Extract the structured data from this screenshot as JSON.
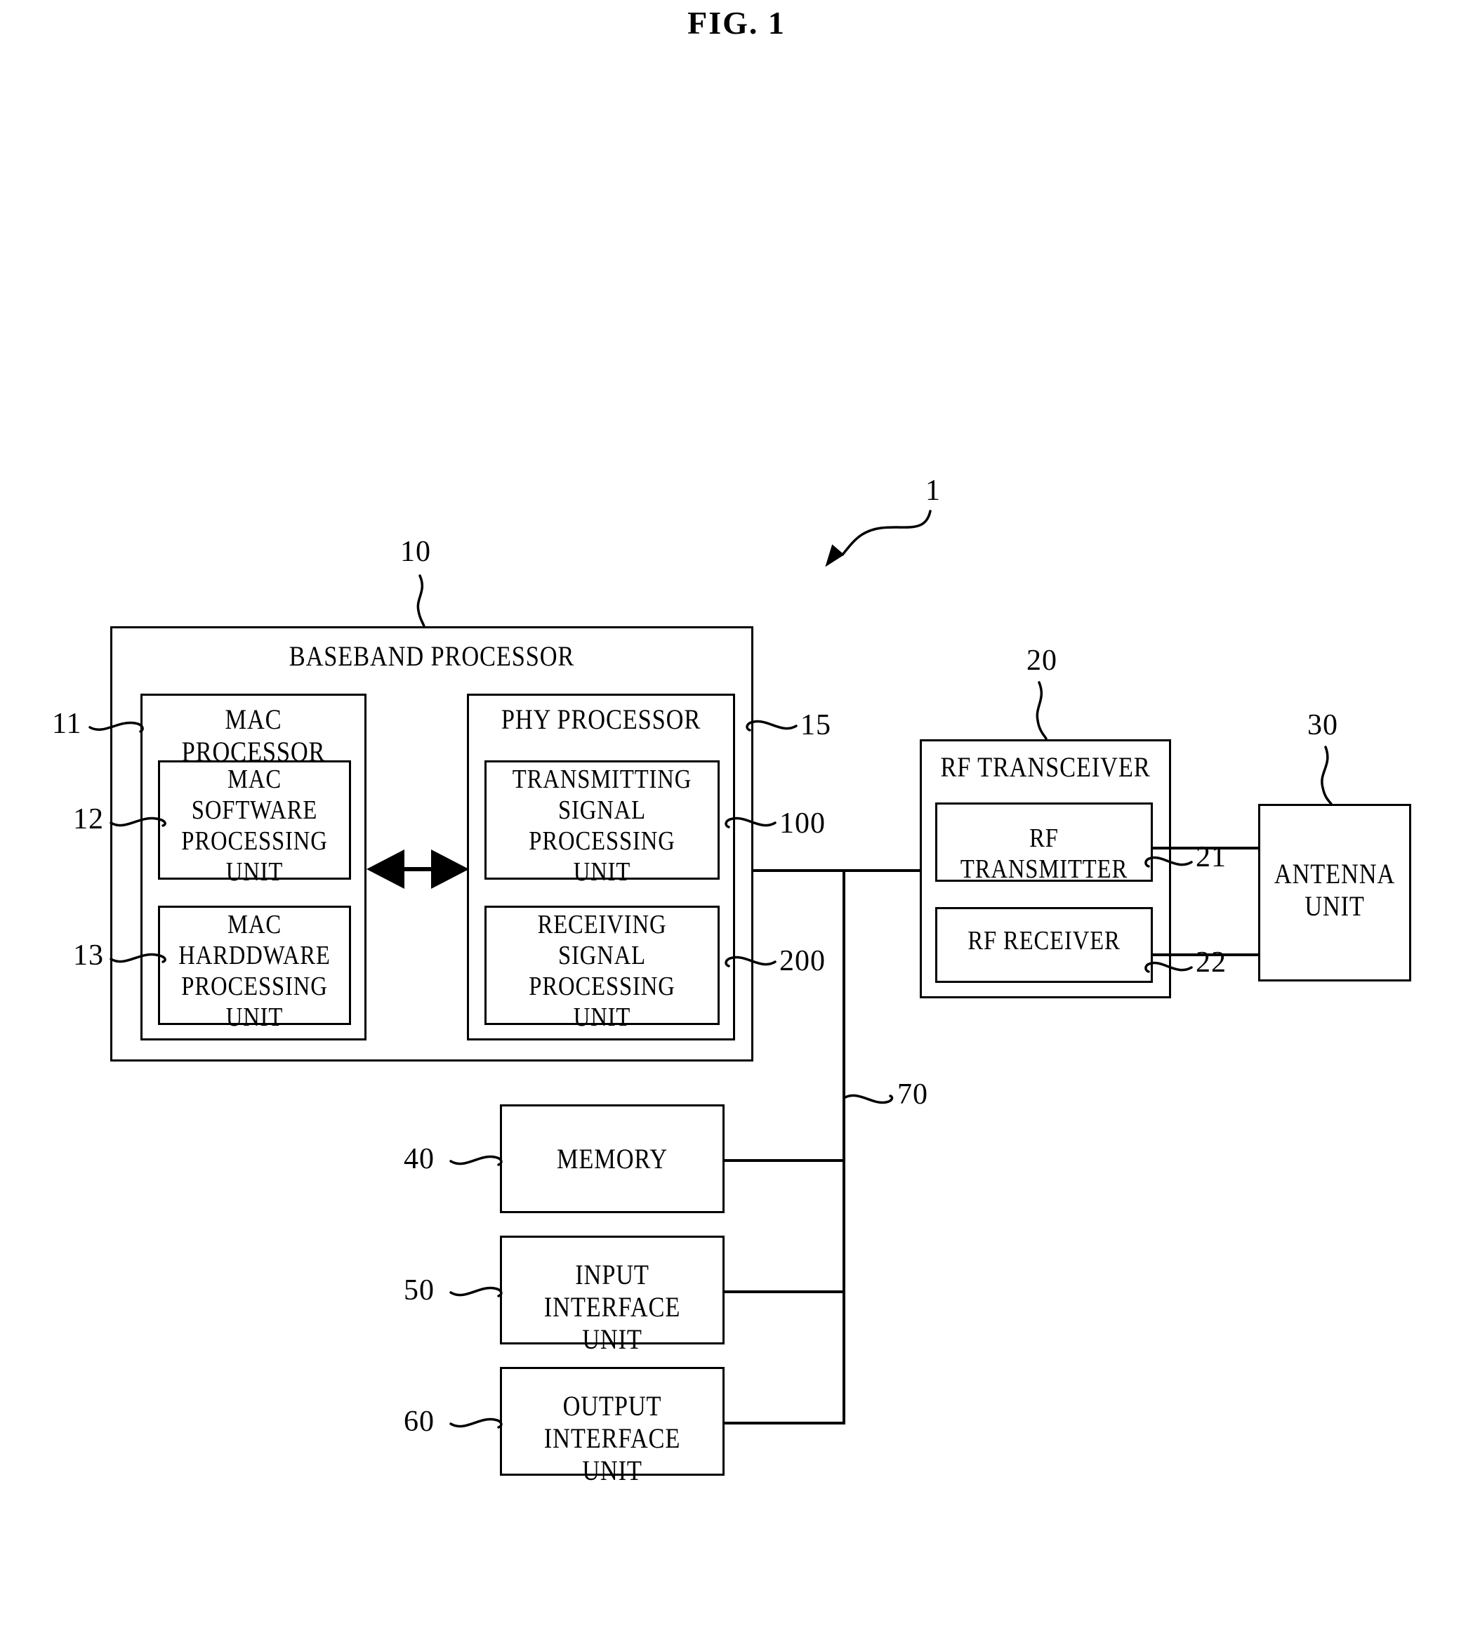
{
  "figure": {
    "title": "FIG. 1",
    "ink_color": "#000000",
    "background_color": "#ffffff"
  },
  "overall_reference": {
    "numeral": "1",
    "note": "curved arrow pointing to the whole apparatus"
  },
  "baseband_processor": {
    "numeral": "10",
    "label": "BASEBAND PROCESSOR",
    "mac_processor": {
      "numeral": "11",
      "label": "MAC PROCESSOR",
      "software_unit": {
        "numeral": "12",
        "label": "MAC SOFTWARE\nPROCESSING\nUNIT"
      },
      "hardware_unit": {
        "numeral": "13",
        "label": "MAC HARDDWARE\nPROCESSING\nUNIT"
      }
    },
    "phy_processor": {
      "numeral": "15",
      "label": "PHY PROCESSOR",
      "transmitting_unit": {
        "numeral": "100",
        "label": "TRANSMITTING\nSIGNAL\nPROCESSING UNIT"
      },
      "receiving_unit": {
        "numeral": "200",
        "label": "RECEIVING\nSIGNAL\nPROCESSING UNIT"
      }
    }
  },
  "rf_transceiver": {
    "numeral": "20",
    "label": "RF TRANSCEIVER",
    "transmitter": {
      "numeral": "21",
      "label": "RF TRANSMITTER"
    },
    "receiver": {
      "numeral": "22",
      "label": "RF RECEIVER"
    }
  },
  "antenna_unit": {
    "numeral": "30",
    "label": "ANTENNA\nUNIT"
  },
  "memory": {
    "numeral": "40",
    "label": "MEMORY"
  },
  "input_interface": {
    "numeral": "50",
    "label": "INPUT\nINTERFACE UNIT"
  },
  "output_interface": {
    "numeral": "60",
    "label": "OUTPUT\nINTERFACE UNIT"
  },
  "bus": {
    "numeral": "70"
  }
}
